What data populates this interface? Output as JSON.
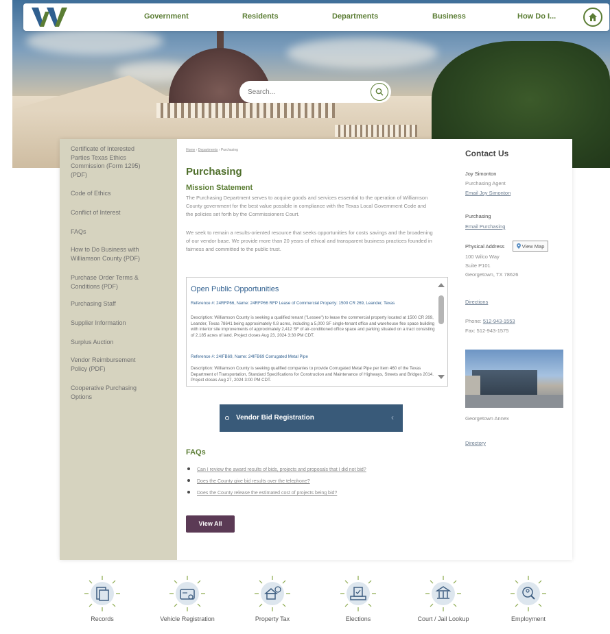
{
  "header": {
    "nav": [
      "Government",
      "Residents",
      "Departments",
      "Business",
      "How Do I..."
    ],
    "home_icon": "home-icon",
    "logo": "williamson-county-w-logo"
  },
  "search": {
    "placeholder": "Search..."
  },
  "sidebar": {
    "items": [
      "Certificate of Interested Parties Texas Ethics Commission (Form 1295) (PDF)",
      "Code of Ethics",
      "Conflict of Interest",
      "FAQs",
      "How to Do Business with Williamson County (PDF)",
      "Purchase Order Terms & Conditions (PDF)",
      "Purchasing Staff",
      "Supplier Information",
      "Surplus Auction",
      "Vendor Reimbursement Policy (PDF)",
      "Cooperative Purchasing Options"
    ]
  },
  "breadcrumb": {
    "home": "Home",
    "sep": " › ",
    "departments": "Departments",
    "current": "Purchasing"
  },
  "main": {
    "title": "Purchasing",
    "mission_heading": "Mission Statement",
    "mission_p1": "The Purchasing Department serves to acquire goods and services essential to the operation of Williamson County government for the best value possible in compliance with the Texas Local Government Code and the policies set forth by the Commissioners Court.",
    "mission_p2": "We seek to remain a results-oriented resource that seeks opportunities for costs savings and the broadening of our vendor base. We provide more than 20 years of ethical and transparent business practices founded in fairness and committed to the public trust."
  },
  "opportunities": {
    "title": "Open Public Opportunities",
    "items": [
      {
        "ref": "Reference #: 24RFP66, Name: 24RFP66 RFP Lease of Commercial Property: 1500 CR 269, Leander, Texas",
        "desc": "Description: Williamson County is seeking a qualified tenant (\"Lessee\") to lease the commercial property located at 1500 CR 269, Leander, Texas 78641 being approximately 0.8 acres, including a 5,000 SF single-tenant office and warehouse flex space building with interior site improvements of approximately 2,412 SF of air-conditioned office space and parking situated on a tract consisting of 2.185 acres of land. Project closes Aug 23, 2024 3:30 PM CDT."
      },
      {
        "ref": "Reference #: 24IFB69, Name: 24IFB69 Corrugated Metal Pipe",
        "desc": "Description: Williamson County is seeking qualified companies to provide Corrugated Metal Pipe per Item 460 of the Texas Department of Transportation, Standard Specifications for Construction and Maintenance of Highways, Streets and Bridges 2014. Project closes Aug 27, 2024 3:00 PM CDT."
      }
    ]
  },
  "vendor_bid": {
    "label": "Vendor Bid Registration",
    "chevron": "‹"
  },
  "faqs": {
    "heading": "FAQs",
    "items": [
      "Can I review the award results of bids, projects and proposals that I did not bid?",
      "Does the County give bid results over the telephone?",
      "Does the County release the estimated cost of projects being bid?"
    ],
    "view_all": "View All"
  },
  "contact": {
    "heading": "Contact Us",
    "person_name": "Joy Simonton",
    "person_title": "Purchasing Agent",
    "person_email": "Email Joy Simonton",
    "dept_name": "Purchasing",
    "dept_email": "Email Purchasing",
    "address_label": "Physical Address",
    "view_map": "View Map",
    "address_line1": "100 Wilco Way",
    "address_line2": "Suite P101",
    "address_line3": "Georgetown, TX 78626",
    "directions": "Directions",
    "phone_label": "Phone: ",
    "phone": "512-943-1553",
    "fax": "Fax: 512-943-1575",
    "annex_caption": "Georgetown Annex",
    "directory": "Directory"
  },
  "quick_links": [
    {
      "label": "Records",
      "icon": "records-icon"
    },
    {
      "label": "Vehicle Registration",
      "icon": "vehicle-registration-icon"
    },
    {
      "label": "Property Tax",
      "icon": "property-tax-icon"
    },
    {
      "label": "Elections",
      "icon": "elections-icon"
    },
    {
      "label": "Court / Jail Lookup",
      "icon": "court-jail-lookup-icon"
    },
    {
      "label": "Employment",
      "icon": "employment-icon"
    }
  ],
  "colors": {
    "brand_green": "#5b7d34",
    "brand_blue": "#2f5f8f",
    "vendor_button": "#395a79",
    "view_all_button": "#5b3a55",
    "sidebar_bg": "#d6d3bf"
  }
}
